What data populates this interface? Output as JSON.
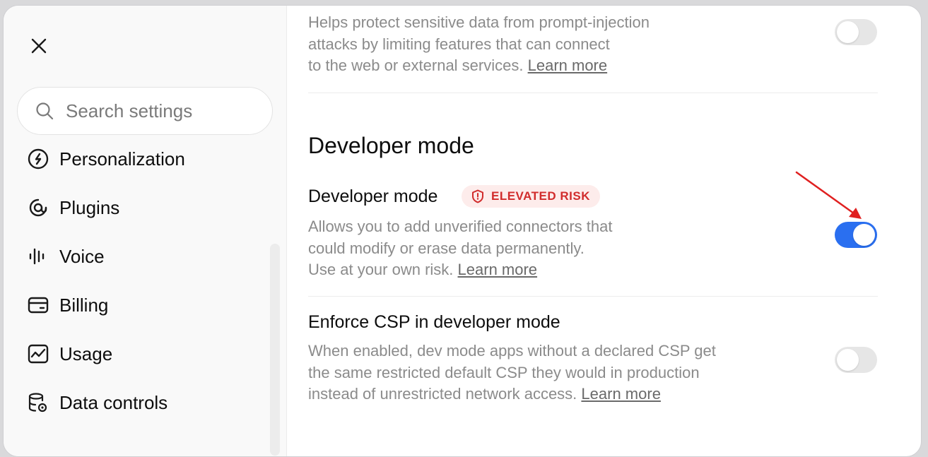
{
  "sidebar": {
    "close_icon": "close-icon",
    "search": {
      "placeholder": "Search settings",
      "value": ""
    },
    "items": [
      {
        "label": "Personalization",
        "icon": "personalization-icon"
      },
      {
        "label": "Plugins",
        "icon": "plugins-icon"
      },
      {
        "label": "Voice",
        "icon": "voice-waveform-icon"
      },
      {
        "label": "Billing",
        "icon": "billing-card-icon"
      },
      {
        "label": "Usage",
        "icon": "usage-chart-icon"
      },
      {
        "label": "Data controls",
        "icon": "data-controls-icon"
      }
    ]
  },
  "main": {
    "top_setting": {
      "description_lines": [
        "Helps protect sensitive data from prompt-injection",
        "attacks by limiting features that can connect",
        "to the web or external services."
      ],
      "learn_more": "Learn more",
      "enabled": false
    },
    "section_title": "Developer mode",
    "developer_mode": {
      "title": "Developer mode",
      "badge": "ELEVATED RISK",
      "description_lines": [
        "Allows you to add unverified connectors that",
        "could modify or erase data permanently.",
        "Use at your own risk."
      ],
      "learn_more": "Learn more",
      "enabled": true
    },
    "enforce_csp": {
      "title": "Enforce CSP in developer mode",
      "description_lines": [
        "When enabled, dev mode apps without a declared CSP get",
        "the same restricted default CSP they would in production",
        "instead of unrestricted network access."
      ],
      "learn_more": "Learn more",
      "enabled": false
    }
  },
  "colors": {
    "toggle_on": "#2a6ff0",
    "toggle_off": "#e6e6e6",
    "risk_text": "#d12c2c",
    "risk_bg": "#fdeceb",
    "annotation_arrow": "#e02020"
  }
}
